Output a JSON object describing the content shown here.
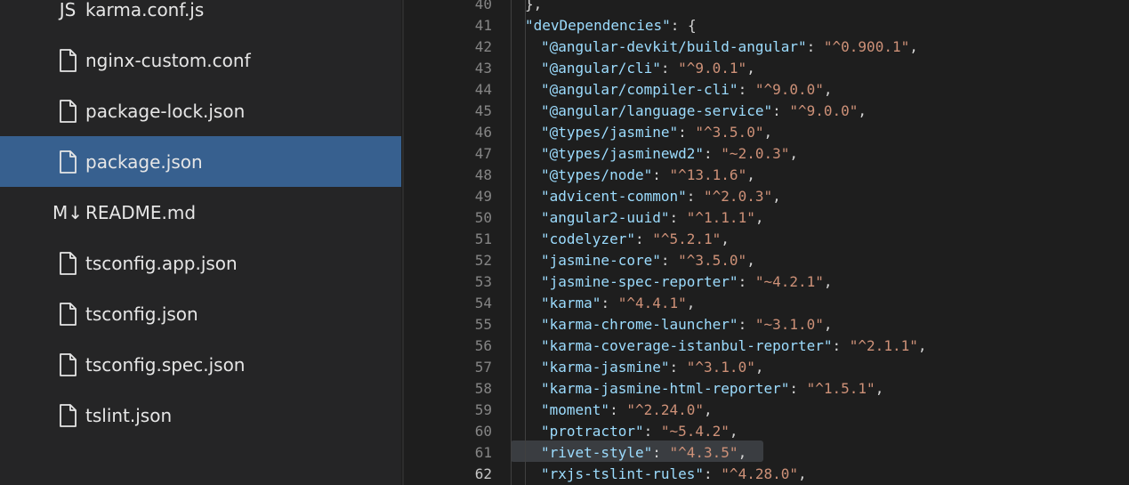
{
  "explorer": {
    "files": [
      {
        "name": "karma.conf.js",
        "icon": "js-icon",
        "icon_text": "JS",
        "selected": false
      },
      {
        "name": "nginx-custom.conf",
        "icon": "file-icon",
        "selected": false
      },
      {
        "name": "package-lock.json",
        "icon": "file-icon",
        "selected": false
      },
      {
        "name": "package.json",
        "icon": "file-icon",
        "selected": true
      },
      {
        "name": "README.md",
        "icon": "markdown-icon",
        "icon_text": "M↓",
        "selected": false
      },
      {
        "name": "tsconfig.app.json",
        "icon": "file-icon",
        "selected": false
      },
      {
        "name": "tsconfig.json",
        "icon": "file-icon",
        "selected": false
      },
      {
        "name": "tsconfig.spec.json",
        "icon": "file-icon",
        "selected": false
      },
      {
        "name": "tslint.json",
        "icon": "file-icon",
        "selected": false
      }
    ]
  },
  "editor": {
    "current_line": 62,
    "highlighted_line": 61,
    "lines": [
      {
        "n": "40",
        "text": "},"
      },
      {
        "n": "41",
        "key": "\"devDependencies\"",
        "rest": ": {",
        "indent": 1
      },
      {
        "n": "42",
        "key": "\"@angular-devkit/build-angular\"",
        "value": "\"^0.900.1\""
      },
      {
        "n": "43",
        "key": "\"@angular/cli\"",
        "value": "\"^9.0.1\""
      },
      {
        "n": "44",
        "key": "\"@angular/compiler-cli\"",
        "value": "\"^9.0.0\""
      },
      {
        "n": "45",
        "key": "\"@angular/language-service\"",
        "value": "\"^9.0.0\""
      },
      {
        "n": "46",
        "key": "\"@types/jasmine\"",
        "value": "\"^3.5.0\""
      },
      {
        "n": "47",
        "key": "\"@types/jasminewd2\"",
        "value": "\"~2.0.3\""
      },
      {
        "n": "48",
        "key": "\"@types/node\"",
        "value": "\"^13.1.6\""
      },
      {
        "n": "49",
        "key": "\"advicent-common\"",
        "value": "\"^2.0.3\""
      },
      {
        "n": "50",
        "key": "\"angular2-uuid\"",
        "value": "\"^1.1.1\""
      },
      {
        "n": "51",
        "key": "\"codelyzer\"",
        "value": "\"^5.2.1\""
      },
      {
        "n": "52",
        "key": "\"jasmine-core\"",
        "value": "\"^3.5.0\""
      },
      {
        "n": "53",
        "key": "\"jasmine-spec-reporter\"",
        "value": "\"~4.2.1\""
      },
      {
        "n": "54",
        "key": "\"karma\"",
        "value": "\"^4.4.1\""
      },
      {
        "n": "55",
        "key": "\"karma-chrome-launcher\"",
        "value": "\"~3.1.0\""
      },
      {
        "n": "56",
        "key": "\"karma-coverage-istanbul-reporter\"",
        "value": "\"^2.1.1\""
      },
      {
        "n": "57",
        "key": "\"karma-jasmine\"",
        "value": "\"^3.1.0\""
      },
      {
        "n": "58",
        "key": "\"karma-jasmine-html-reporter\"",
        "value": "\"^1.5.1\""
      },
      {
        "n": "59",
        "key": "\"moment\"",
        "value": "\"^2.24.0\""
      },
      {
        "n": "60",
        "key": "\"protractor\"",
        "value": "\"~5.4.2\""
      },
      {
        "n": "61",
        "key": "\"rivet-style\"",
        "value": "\"^4.3.5\""
      },
      {
        "n": "62",
        "key": "\"rxjs-tslint-rules\"",
        "value": "\"^4.28.0\""
      }
    ]
  }
}
